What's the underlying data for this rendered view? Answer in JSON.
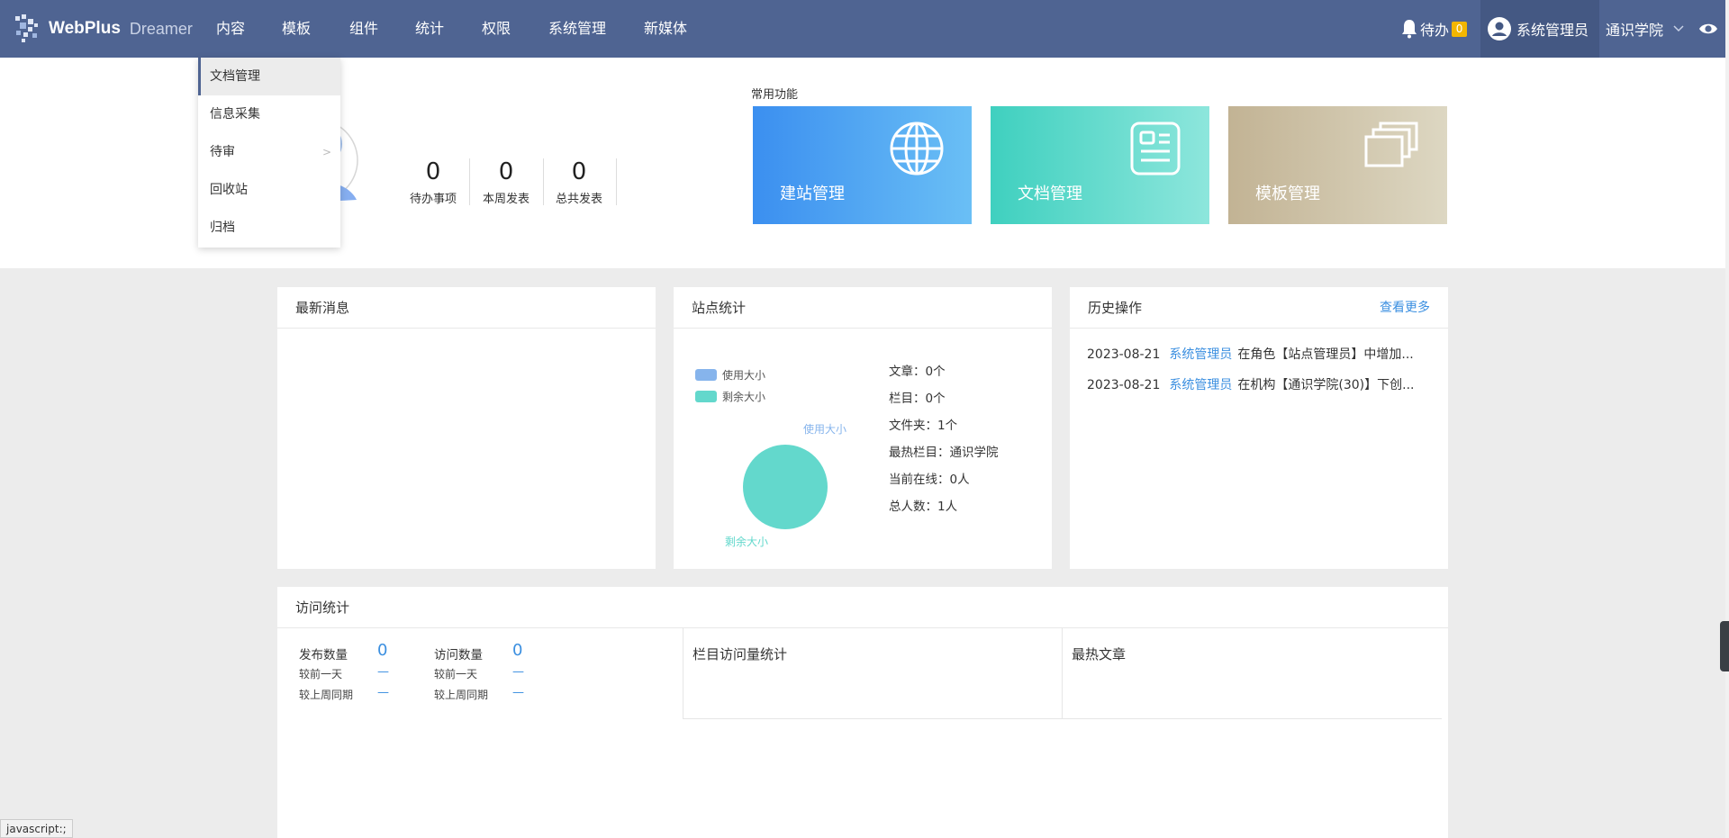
{
  "nav": {
    "brand": "WebPlus",
    "brand_sub": "Dreamer",
    "items": [
      "内容",
      "模板",
      "组件",
      "统计",
      "权限",
      "系统管理",
      "新媒体"
    ],
    "todo_label": "待办",
    "todo_count": "0",
    "user": "系统管理员",
    "org": "通识学院"
  },
  "dropdown": {
    "items": [
      "文档管理",
      "信息采集",
      "待审",
      "回收站",
      "归档"
    ]
  },
  "summary": {
    "stats": [
      {
        "value": "0",
        "label": "待办事项"
      },
      {
        "value": "0",
        "label": "本周发表"
      },
      {
        "value": "0",
        "label": "总共发表"
      }
    ]
  },
  "common": {
    "title": "常用功能",
    "tiles": [
      {
        "label": "建站管理",
        "icon": "globe-icon"
      },
      {
        "label": "文档管理",
        "icon": "document-icon"
      },
      {
        "label": "模板管理",
        "icon": "windows-icon"
      }
    ]
  },
  "news": {
    "title": "最新消息"
  },
  "site": {
    "title": "站点统计",
    "legend": [
      "使用大小",
      "剩余大小"
    ],
    "pie_labels": {
      "used": "使用大小",
      "free": "剩余大小"
    },
    "stats": [
      {
        "label": "文章：",
        "value": "0个"
      },
      {
        "label": "栏目：",
        "value": "0个"
      },
      {
        "label": "文件夹：",
        "value": "1个"
      },
      {
        "label": "最热栏目：",
        "value": "通识学院"
      },
      {
        "label": "当前在线：",
        "value": "0人"
      },
      {
        "label": "总人数：",
        "value": "1人"
      }
    ]
  },
  "history": {
    "title": "历史操作",
    "more": "查看更多",
    "rows": [
      {
        "date": "2023-08-21",
        "who": "系统管理员",
        "text": "在角色【站点管理员】中增加..."
      },
      {
        "date": "2023-08-21",
        "who": "系统管理员",
        "text": "在机构【通识学院(30)】下创..."
      }
    ]
  },
  "visit": {
    "title": "访问统计",
    "publish_label": "发布数量",
    "publish_value": "0",
    "visit_label": "访问数量",
    "visit_value": "0",
    "prev_day": "较前一天",
    "prev_week": "较上周同期",
    "dash": "—",
    "column_stats": "栏目访问量统计",
    "hot_articles": "最热文章"
  },
  "status_tip": "javascript:;",
  "colors": {
    "nav": "#4f6492",
    "accent": "#3b8fe0",
    "teal": "#63d8cc",
    "badge": "#f3b600"
  }
}
